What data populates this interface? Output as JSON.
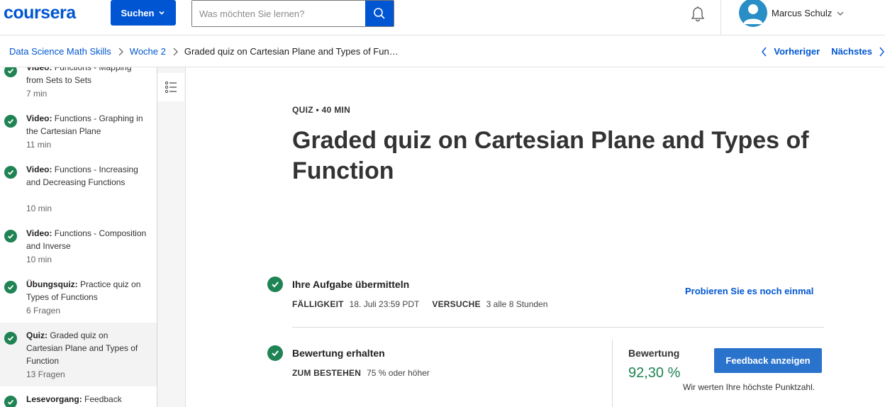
{
  "header": {
    "logo_text": "coursera",
    "search_button_label": "Suchen",
    "search_placeholder": "Was möchten Sie lernen?",
    "user_name": "Marcus Schulz"
  },
  "breadcrumb": {
    "items": [
      "Data Science Math Skills",
      "Woche 2"
    ],
    "current": "Graded quiz on Cartesian Plane and Types of Fun…",
    "prev_label": "Vorheriger",
    "next_label": "Nächstes"
  },
  "sidebar": {
    "items": [
      {
        "type": "Video:",
        "text": " Functions - Mapping from Sets to Sets",
        "meta": "7 min",
        "completed": true
      },
      {
        "type": "Video:",
        "text": " Functions - Graphing in the Cartesian Plane",
        "meta": "11 min",
        "completed": true
      },
      {
        "type": "Video:",
        "text": " Functions - Increasing and Decreasing Functions",
        "meta": "10 min",
        "completed": true
      },
      {
        "type": "Video:",
        "text": " Functions - Composition and Inverse",
        "meta": "10 min",
        "completed": true
      },
      {
        "type": "Übungsquiz:",
        "text": " Practice quiz on Types of Functions",
        "meta": "6 Fragen",
        "completed": true
      },
      {
        "type": "Quiz:",
        "text": " Graded quiz on Cartesian Plane and Types of Function",
        "meta": "13 Fragen",
        "completed": true,
        "active": true
      },
      {
        "type": "Lesevorgang:",
        "text": " Feedback",
        "meta": "",
        "completed": true
      }
    ]
  },
  "main": {
    "kicker": "QUIZ • 40 MIN",
    "title": "Graded quiz on Cartesian Plane and Types of Function",
    "submit": {
      "title": "Ihre Aufgabe übermitteln",
      "due_label": "FÄLLIGKEIT",
      "due_value": "18. Juli 23:59 PDT",
      "attempts_label": "VERSUCHE",
      "attempts_value": "3 alle 8 Stunden",
      "retry_label": "Probieren Sie es noch einmal"
    },
    "grade": {
      "title": "Bewertung erhalten",
      "pass_label": "ZUM BESTEHEN",
      "pass_value": "75 % oder höher",
      "grade_label": "Bewertung",
      "grade_value": "92,30 %",
      "feedback_button": "Feedback anzeigen",
      "note": "Wir werten Ihre höchste Punktzahl."
    }
  },
  "colors": {
    "brand": "#0056d2",
    "success": "#1f8354",
    "button": "#2a73cc"
  }
}
